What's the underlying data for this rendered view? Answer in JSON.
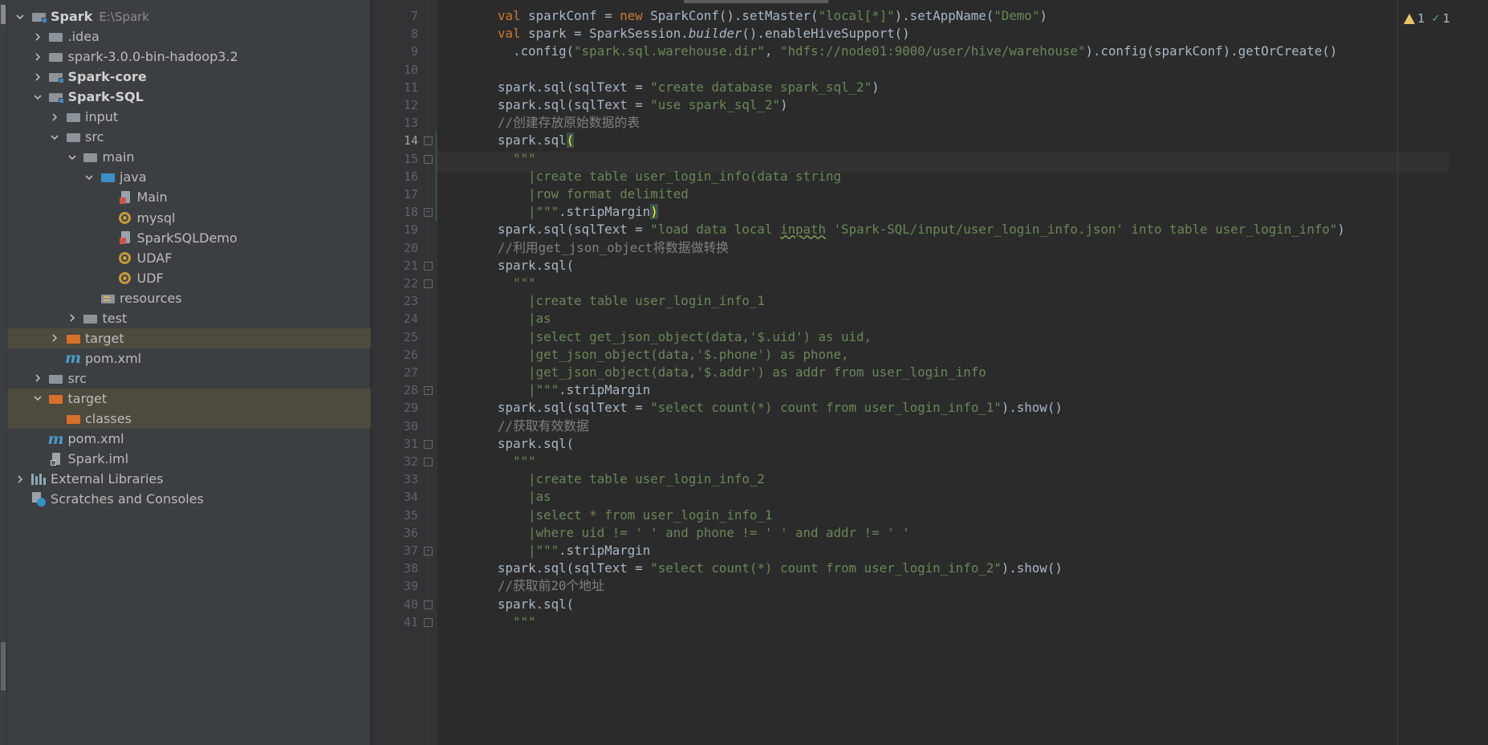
{
  "project_tree": {
    "items": [
      {
        "label": "Spark",
        "hint": "E:\\Spark",
        "icon": "module-folder-icon",
        "depth": 0,
        "expanded": true,
        "bold": true
      },
      {
        "label": ".idea",
        "icon": "folder-icon",
        "depth": 1,
        "expanded": false
      },
      {
        "label": "spark-3.0.0-bin-hadoop3.2",
        "icon": "folder-icon",
        "depth": 1,
        "expanded": false
      },
      {
        "label": "Spark-core",
        "icon": "module-folder-icon",
        "depth": 1,
        "expanded": false,
        "bold": true
      },
      {
        "label": "Spark-SQL",
        "icon": "module-folder-icon",
        "depth": 1,
        "expanded": true,
        "bold": true
      },
      {
        "label": "input",
        "icon": "folder-icon",
        "depth": 2,
        "expanded": false
      },
      {
        "label": "src",
        "icon": "folder-icon",
        "depth": 2,
        "expanded": true
      },
      {
        "label": "main",
        "icon": "folder-icon",
        "depth": 3,
        "expanded": true
      },
      {
        "label": "java",
        "icon": "source-folder-icon",
        "depth": 4,
        "expanded": true
      },
      {
        "label": "Main",
        "icon": "scala-class-icon",
        "depth": 5
      },
      {
        "label": "mysql",
        "icon": "scala-object-icon",
        "depth": 5
      },
      {
        "label": "SparkSQLDemo",
        "icon": "scala-class-icon",
        "depth": 5
      },
      {
        "label": "UDAF",
        "icon": "scala-object-icon",
        "depth": 5
      },
      {
        "label": "UDF",
        "icon": "scala-object-icon",
        "depth": 5
      },
      {
        "label": "resources",
        "icon": "resources-folder-icon",
        "depth": 4
      },
      {
        "label": "test",
        "icon": "folder-icon",
        "depth": 3,
        "expanded": false
      },
      {
        "label": "target",
        "icon": "excluded-folder-icon",
        "depth": 2,
        "expanded": false,
        "excluded": true
      },
      {
        "label": "pom.xml",
        "icon": "maven-icon",
        "depth": 2
      },
      {
        "label": "src",
        "icon": "folder-icon",
        "depth": 1,
        "expanded": false
      },
      {
        "label": "target",
        "icon": "excluded-folder-icon",
        "depth": 1,
        "expanded": true,
        "excluded": true
      },
      {
        "label": "classes",
        "icon": "excluded-folder-icon",
        "depth": 2,
        "excluded": true
      },
      {
        "label": "pom.xml",
        "icon": "maven-icon",
        "depth": 1
      },
      {
        "label": "Spark.iml",
        "icon": "iml-file-icon",
        "depth": 1
      },
      {
        "label": "External Libraries",
        "icon": "libraries-icon",
        "depth": 0,
        "expanded": false
      },
      {
        "label": "Scratches and Consoles",
        "icon": "scratches-icon",
        "depth": 0
      }
    ]
  },
  "editor": {
    "current_line": 14,
    "inspections": {
      "warnings": "1",
      "typos": "1"
    },
    "lines": [
      {
        "n": "7",
        "t": [
          [
            "    ",
            ""
          ],
          [
            "val ",
            "kw"
          ],
          [
            "sparkConf = ",
            ""
          ],
          [
            "new ",
            "kw"
          ],
          [
            "SparkConf().setMaster(",
            ""
          ],
          [
            "\"local[*]\"",
            "str"
          ],
          [
            ").setAppName(",
            ""
          ],
          [
            "\"Demo\"",
            "str"
          ],
          [
            ")",
            ""
          ]
        ]
      },
      {
        "n": "8",
        "t": [
          [
            "    ",
            ""
          ],
          [
            "val ",
            "kw"
          ],
          [
            "spark = SparkSession.",
            ""
          ],
          [
            "builder",
            "it"
          ],
          [
            "().enableHiveSupport()",
            ""
          ]
        ]
      },
      {
        "n": "9",
        "t": [
          [
            "      .config(",
            ""
          ],
          [
            "\"spark.sql.warehouse.dir\"",
            "str"
          ],
          [
            ", ",
            ""
          ],
          [
            "\"hdfs://node01:9000/user/hive/warehouse\"",
            "str"
          ],
          [
            ").config(sparkConf).getOrCreate()",
            ""
          ]
        ]
      },
      {
        "n": "10",
        "t": []
      },
      {
        "n": "11",
        "t": [
          [
            "    spark.sql(sqlText = ",
            ""
          ],
          [
            "\"create database spark_sql_2\"",
            "str"
          ],
          [
            ")",
            ""
          ]
        ]
      },
      {
        "n": "12",
        "t": [
          [
            "    spark.sql(sqlText = ",
            ""
          ],
          [
            "\"use spark_sql_2\"",
            "str"
          ],
          [
            ")",
            ""
          ]
        ]
      },
      {
        "n": "13",
        "t": [
          [
            "    //创建存放原始数据的表",
            "cm"
          ]
        ]
      },
      {
        "n": "14",
        "t": [
          [
            "    spark.sql",
            ""
          ],
          [
            "(",
            "brace"
          ]
        ],
        "fold": "start"
      },
      {
        "n": "15",
        "t": [
          [
            "      ",
            ""
          ],
          [
            "\"\"\"",
            "str"
          ]
        ],
        "fold": "start"
      },
      {
        "n": "16",
        "t": [
          [
            "        ",
            ""
          ],
          [
            "|create table user_login_info(data string",
            "str"
          ]
        ]
      },
      {
        "n": "17",
        "t": [
          [
            "        ",
            ""
          ],
          [
            "|row format delimited",
            "str"
          ]
        ]
      },
      {
        "n": "18",
        "t": [
          [
            "        ",
            ""
          ],
          [
            "|\"\"\"",
            "str"
          ],
          [
            ".stripMargin",
            ""
          ],
          [
            ")",
            "brace"
          ]
        ],
        "fold": "end"
      },
      {
        "n": "19",
        "t": [
          [
            "    spark.sql(sqlText = ",
            ""
          ],
          [
            "\"load data local ",
            "str"
          ],
          [
            "inpath",
            "str warn-ul"
          ],
          [
            " 'Spark-SQL/input/user_login_info.json' into table user_login_info\"",
            "str"
          ],
          [
            ")",
            ""
          ]
        ]
      },
      {
        "n": "20",
        "t": [
          [
            "    //利用get_json_object将数据做转换",
            "cm"
          ]
        ]
      },
      {
        "n": "21",
        "t": [
          [
            "    spark.sql(",
            ""
          ]
        ],
        "fold": "start"
      },
      {
        "n": "22",
        "t": [
          [
            "      ",
            ""
          ],
          [
            "\"\"\"",
            "str"
          ]
        ],
        "fold": "start"
      },
      {
        "n": "23",
        "t": [
          [
            "        ",
            ""
          ],
          [
            "|create table user_login_info_1",
            "str"
          ]
        ]
      },
      {
        "n": "24",
        "t": [
          [
            "        ",
            ""
          ],
          [
            "|as",
            "str"
          ]
        ]
      },
      {
        "n": "25",
        "t": [
          [
            "        ",
            ""
          ],
          [
            "|select get_json_object(data,'$.uid') as uid,",
            "str"
          ]
        ]
      },
      {
        "n": "26",
        "t": [
          [
            "        ",
            ""
          ],
          [
            "|get_json_object(data,'$.phone') as phone,",
            "str"
          ]
        ]
      },
      {
        "n": "27",
        "t": [
          [
            "        ",
            ""
          ],
          [
            "|get_json_object(data,'$.addr') as addr from user_login_info",
            "str"
          ]
        ]
      },
      {
        "n": "28",
        "t": [
          [
            "        ",
            ""
          ],
          [
            "|\"\"\"",
            "str"
          ],
          [
            ".stripMargin",
            ""
          ]
        ],
        "fold": "end"
      },
      {
        "n": "29",
        "t": [
          [
            "    spark.sql(sqlText = ",
            ""
          ],
          [
            "\"select count(*) count from user_login_info_1\"",
            "str"
          ],
          [
            ").show()",
            ""
          ]
        ]
      },
      {
        "n": "30",
        "t": [
          [
            "    //获取有效数据",
            "cm"
          ]
        ]
      },
      {
        "n": "31",
        "t": [
          [
            "    spark.sql(",
            ""
          ]
        ],
        "fold": "start"
      },
      {
        "n": "32",
        "t": [
          [
            "      ",
            ""
          ],
          [
            "\"\"\"",
            "str"
          ]
        ],
        "fold": "start"
      },
      {
        "n": "33",
        "t": [
          [
            "        ",
            ""
          ],
          [
            "|create table user_login_info_2",
            "str"
          ]
        ]
      },
      {
        "n": "34",
        "t": [
          [
            "        ",
            ""
          ],
          [
            "|as",
            "str"
          ]
        ]
      },
      {
        "n": "35",
        "t": [
          [
            "        ",
            ""
          ],
          [
            "|select * from user_login_info_1",
            "str"
          ]
        ]
      },
      {
        "n": "36",
        "t": [
          [
            "        ",
            ""
          ],
          [
            "|where uid != ' ' and phone != ' ' and addr != ' '",
            "str"
          ]
        ]
      },
      {
        "n": "37",
        "t": [
          [
            "        ",
            ""
          ],
          [
            "|\"\"\"",
            "str"
          ],
          [
            ".stripMargin",
            ""
          ]
        ],
        "fold": "end"
      },
      {
        "n": "38",
        "t": [
          [
            "    spark.sql(sqlText = ",
            ""
          ],
          [
            "\"select count(*) count from user_login_info_2\"",
            "str"
          ],
          [
            ").show()",
            ""
          ]
        ]
      },
      {
        "n": "39",
        "t": [
          [
            "    //获取前20个地址",
            "cm"
          ]
        ]
      },
      {
        "n": "40",
        "t": [
          [
            "    spark.sql(",
            ""
          ]
        ],
        "fold": "start"
      },
      {
        "n": "41",
        "t": [
          [
            "      ",
            ""
          ],
          [
            "\"\"\"",
            "str"
          ]
        ],
        "fold": "start"
      }
    ]
  }
}
